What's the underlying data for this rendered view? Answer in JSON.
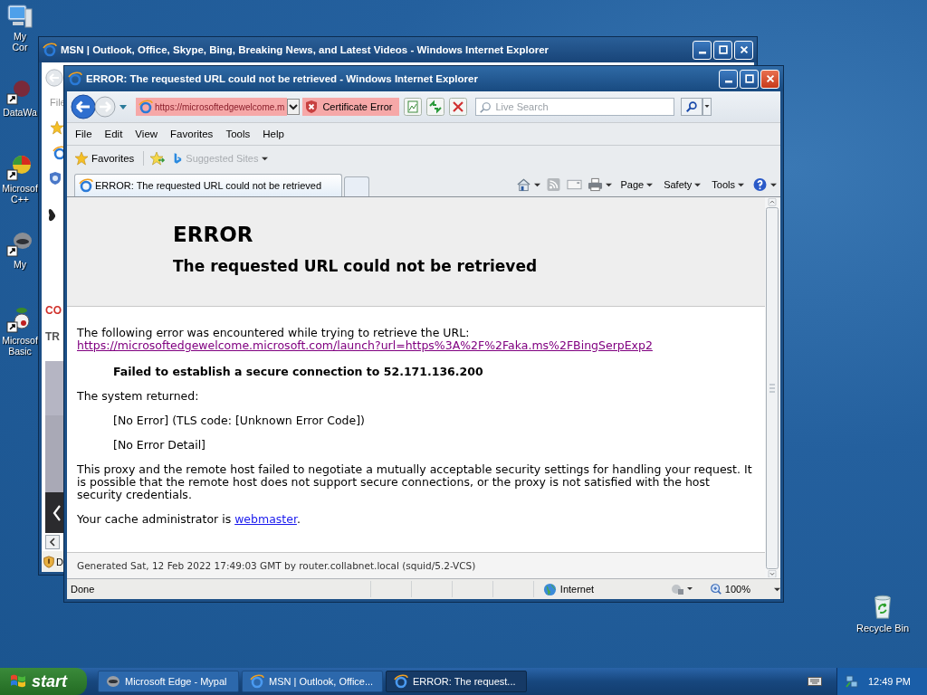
{
  "desktop": {
    "icons": [
      {
        "label": "My Cor",
        "kind": "computer"
      },
      {
        "label": "DataWa",
        "kind": "shortcut"
      },
      {
        "label": "Microsof C++",
        "kind": "pie"
      },
      {
        "label": "My",
        "kind": "raccoon"
      },
      {
        "label": "Microsof Basic",
        "kind": "plant"
      }
    ],
    "recycle_bin": {
      "label": "Recycle Bin"
    }
  },
  "background_window": {
    "title": "MSN | Outlook, Office, Skype, Bing, Breaking News, and Latest Videos - Windows Internet Explorer",
    "menu_item": "File",
    "fragments": [
      "CO",
      "TR"
    ],
    "status": "D"
  },
  "browser": {
    "title": "ERROR: The requested URL could not be retrieved - Windows Internet Explorer",
    "address": "https://microsoftedgewelcome.m",
    "certificate": "Certificate Error",
    "search": {
      "placeholder": "Live Search"
    },
    "menu": [
      "File",
      "Edit",
      "View",
      "Favorites",
      "Tools",
      "Help"
    ],
    "favorites": "Favorites",
    "suggested_sites": "Suggested Sites",
    "tabs": [
      {
        "label": "ERROR: The requested URL could not be retrieved",
        "selected": true
      }
    ],
    "commands": [
      "Page",
      "Safety",
      "Tools"
    ],
    "page": {
      "heading": "ERROR",
      "subheading": "The requested URL could not be retrieved",
      "intro": "The following error was encountered while trying to retrieve the URL:",
      "url": "https://microsoftedgewelcome.microsoft.com/launch?url=https%3A%2F%2Faka.ms%2FBingSerpExp2",
      "failure": "Failed to establish a secure connection to 52.171.136.200",
      "system_returned": "The system returned:",
      "details": [
        "[No Error] (TLS code: [Unknown Error Code])",
        "[No Error Detail]"
      ],
      "explanation": "This proxy and the remote host failed to negotiate a mutually acceptable security settings for handling your request. It is possible that the remote host does not support secure connections, or the proxy is not satisfied with the host security credentials.",
      "admin_text": "Your cache administrator is ",
      "admin_link": "webmaster",
      "admin_end": ".",
      "footer": "Generated Sat, 12 Feb 2022 17:49:03 GMT by router.collabnet.local (squid/5.2-VCS)"
    },
    "status_bar": {
      "text": "Done",
      "zone": "Internet",
      "zoom": "100%"
    }
  },
  "taskbar": {
    "start": "start",
    "tasks": [
      {
        "label": "Microsoft Edge - Mypal",
        "selected": false,
        "kind": "raccoon"
      },
      {
        "label": "MSN | Outlook, Office...",
        "selected": false,
        "kind": "ie"
      },
      {
        "label": "ERROR: The request...",
        "selected": true,
        "kind": "ie"
      }
    ],
    "clock": "12:49 PM"
  }
}
